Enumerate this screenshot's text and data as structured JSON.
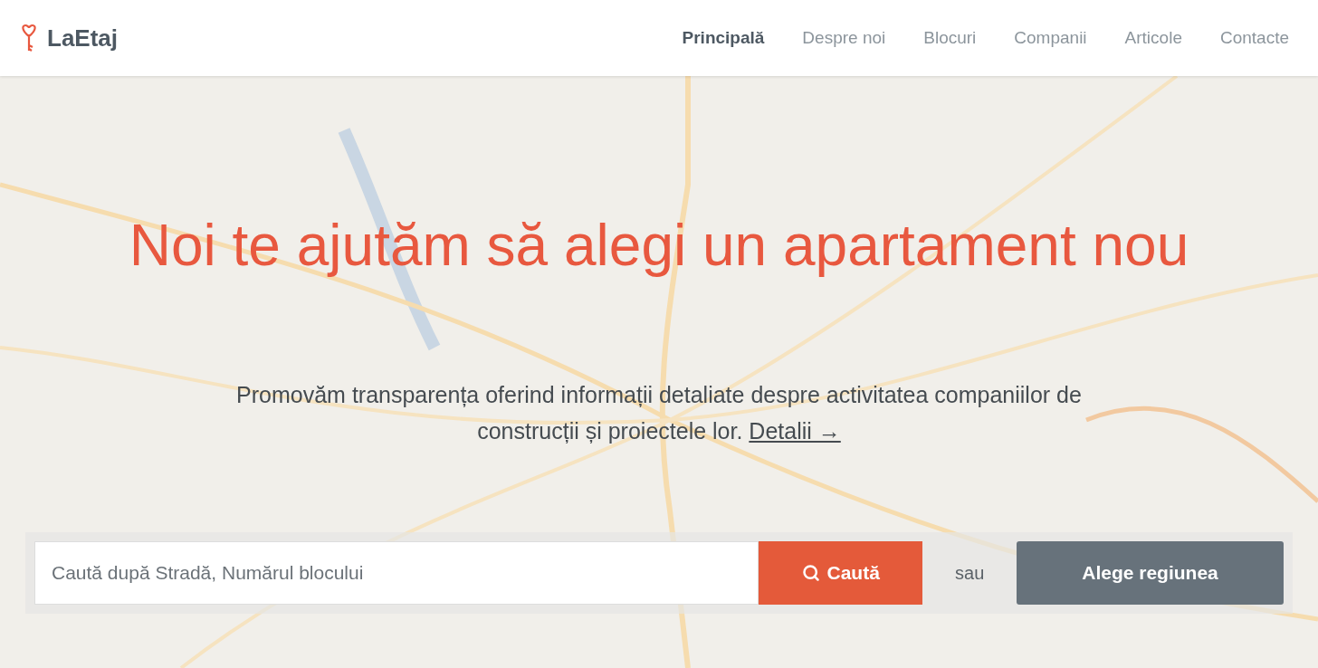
{
  "header": {
    "logo": "LaEtaj",
    "nav": [
      {
        "label": "Principală",
        "selected": true
      },
      {
        "label": "Despre noi",
        "selected": false
      },
      {
        "label": "Blocuri",
        "selected": false
      },
      {
        "label": "Companii",
        "selected": false
      },
      {
        "label": "Articole",
        "selected": false
      },
      {
        "label": "Contacte",
        "selected": false
      }
    ]
  },
  "hero": {
    "title": "Noi te ajutăm să alegi un apartament nou",
    "subtitle": "Promovăm transparența oferind informații detaliate despre activitatea companiilor de construcții și proiectele lor.",
    "link": "Detalii →"
  },
  "search": {
    "placeholder": "Caută după Stradă, Numărul blocului",
    "button": "Caută",
    "separator": "sau",
    "region_button": "Alege regiunea"
  }
}
